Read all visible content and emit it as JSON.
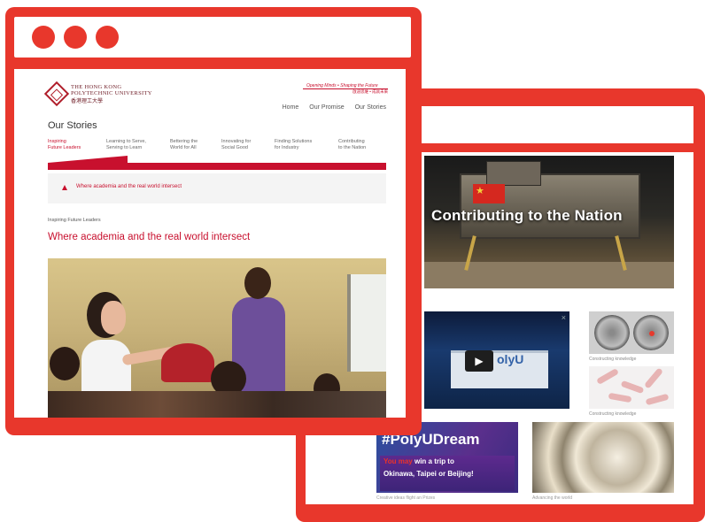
{
  "colors": {
    "frame": "#e8372c",
    "brand": "#c8102e"
  },
  "back_window": {
    "hero_title": "Contributing to the Nation",
    "video": {
      "logo": "olyU",
      "play_icon": "play-icon",
      "close": "×"
    },
    "tiles": [
      {
        "caption": "Constructing knowledge"
      },
      {
        "caption": "Constructing knowledge"
      }
    ],
    "dream": {
      "title": "#PolyUDream",
      "line1_highlight": "You may",
      "line1_rest": " win a trip to",
      "line2": "Okinawa, Taipei or Beijing!",
      "caption": "Creative ideas flight an Prizes"
    },
    "metal_caption": "Advancing the world"
  },
  "front_window": {
    "logo": {
      "en_line1": "THE HONG KONG",
      "en_line2": "POLYTECHNIC UNIVERSITY",
      "cn": "香港理工大學"
    },
    "tagline": "Opening Minds • Shaping the Future",
    "tagline_cn": "啟迪思維 • 成就未來",
    "topnav": [
      "Home",
      "Our Promise",
      "Our Stories"
    ],
    "section_title": "Our Stories",
    "subnav": [
      {
        "line1": "Inspiring",
        "line2": "Future Leaders",
        "active": true
      },
      {
        "line1": "Learning to Serve,",
        "line2": "Serving to Learn",
        "active": false
      },
      {
        "line1": "Bettering the",
        "line2": "World for All",
        "active": false
      },
      {
        "line1": "Innovating for",
        "line2": "Social Good",
        "active": false
      },
      {
        "line1": "Finding Solutions",
        "line2": "for Industry",
        "active": false
      },
      {
        "line1": "Contributing",
        "line2": "to the Nation",
        "active": false
      }
    ],
    "breadcrumb": "Where academia and the real world intersect",
    "kicker": "Inspiring Future Leaders",
    "headline": "Where academia and the real world intersect"
  }
}
